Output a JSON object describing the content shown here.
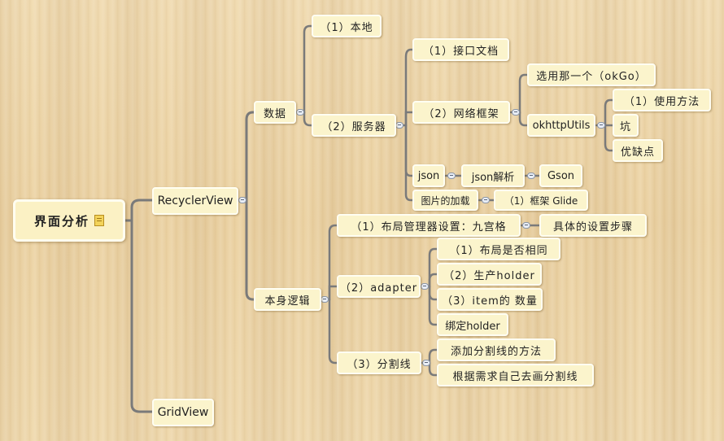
{
  "root": "界面分析",
  "recyclerview": "RecyclerView",
  "gridview": "GridView",
  "data": "数据",
  "local": "（1）本地",
  "server": "（2）服务器",
  "api_doc": "（1）接口文档",
  "net_framework": "（2）网络框架",
  "choose_one": "选用那一个（okGo）",
  "okhttputils": "okhttpUtils",
  "usage": "（1）使用方法",
  "pitfall": "坑",
  "pros_cons": "优缺点",
  "json": "json",
  "json_parse": "json解析",
  "gson": "Gson",
  "image_load": "图片的加载",
  "glide": "（1）框架  Glide",
  "own_logic": "本身逻辑",
  "layout_manager": "（1）布局管理器设置：九宫格",
  "layout_steps": "具体的设置步骤",
  "adapter": "（2）adapter",
  "layout_same": "（1）布局是否相同",
  "create_holder": "（2）生产holder",
  "item_count": "（3）item的 数量",
  "bind_holder": "绑定holder",
  "divider": "（3）分割线",
  "add_divider": "添加分割线的方法",
  "draw_divider": "根据需求自己去画分割线"
}
